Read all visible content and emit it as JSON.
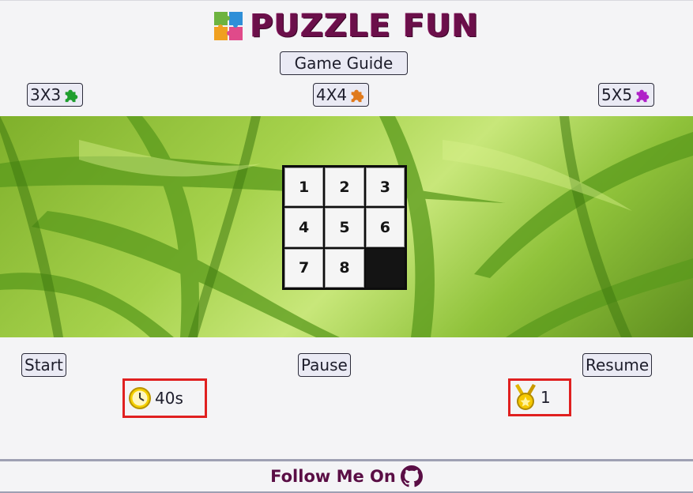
{
  "header": {
    "title": "PUZZLE FUN",
    "logo_icon": "puzzle-logo-icon"
  },
  "guide_button": {
    "label": "Game Guide"
  },
  "size_buttons": [
    {
      "label": "3X3",
      "icon": "puzzle-piece-icon",
      "icon_color": "#1f9e2f"
    },
    {
      "label": "4X4",
      "icon": "puzzle-piece-icon",
      "icon_color": "#e07a1c"
    },
    {
      "label": "5X5",
      "icon": "puzzle-piece-icon",
      "icon_color": "#b020c8"
    }
  ],
  "board": {
    "tiles": [
      "1",
      "2",
      "3",
      "4",
      "5",
      "6",
      "7",
      "8",
      ""
    ]
  },
  "controls": {
    "start_label": "Start",
    "pause_label": "Pause",
    "resume_label": "Resume"
  },
  "timer": {
    "icon": "clock-icon",
    "value": "40s"
  },
  "moves": {
    "icon": "medal-icon",
    "value": "1"
  },
  "footer": {
    "text": "Follow Me On",
    "icon": "github-icon"
  },
  "colors": {
    "title": "#6b0f4a",
    "stat_border": "#e02020",
    "footer_text": "#5a0e45"
  }
}
